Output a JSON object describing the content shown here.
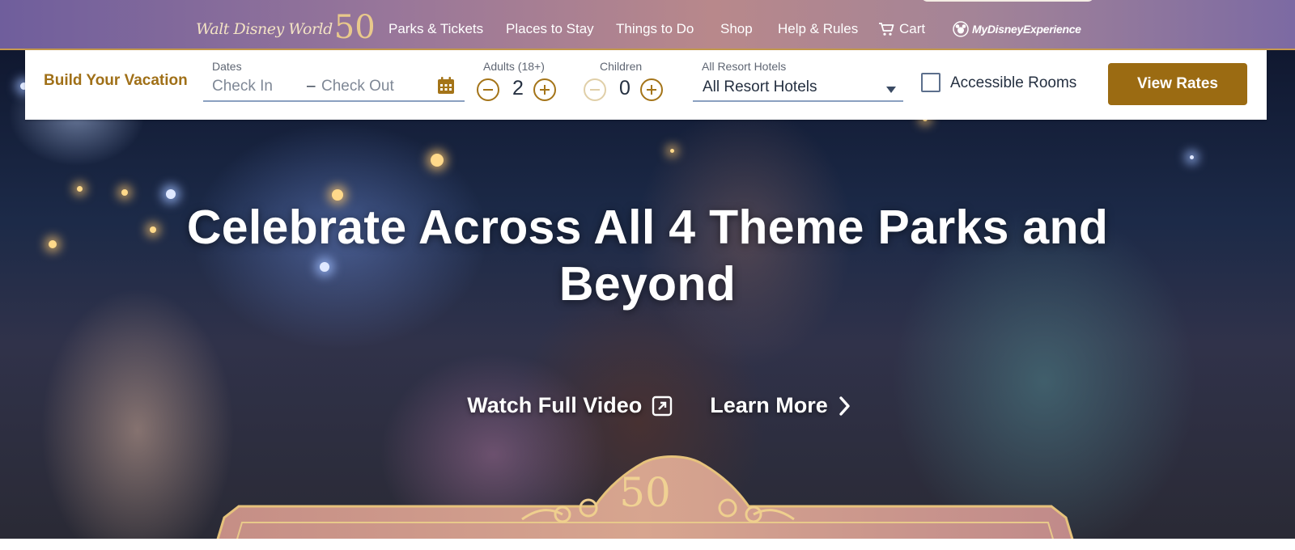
{
  "header": {
    "logo_text": "Walt Disney World",
    "logo_50": "50",
    "nav": [
      {
        "label": "Parks & Tickets"
      },
      {
        "label": "Places to Stay"
      },
      {
        "label": "Things to Do"
      },
      {
        "label": "Shop"
      },
      {
        "label": "Help & Rules"
      },
      {
        "label": "Cart",
        "icon": "cart-icon"
      }
    ],
    "my_disney_experience": "MyDisneyExperience"
  },
  "booking": {
    "title": "Build Your Vacation",
    "dates_label": "Dates",
    "check_in_placeholder": "Check In",
    "dash": "–",
    "check_out_placeholder": "Check Out",
    "adults_label": "Adults (18+)",
    "adults_value": "2",
    "children_label": "Children",
    "children_value": "0",
    "hotels_label": "All Resort Hotels",
    "hotels_selected": "All Resort Hotels",
    "accessible_label": "Accessible Rooms",
    "accessible_checked": false,
    "view_rates_label": "View Rates"
  },
  "hero": {
    "headline": "Celebrate Across All 4 Theme Parks and Beyond",
    "watch_video_label": "Watch Full Video",
    "learn_more_label": "Learn More",
    "ornament_text": "50"
  },
  "colors": {
    "accent_gold": "#9b6b12",
    "nav_gradient_start": "#6f5e9c",
    "nav_gradient_end": "#7c6aa3"
  }
}
